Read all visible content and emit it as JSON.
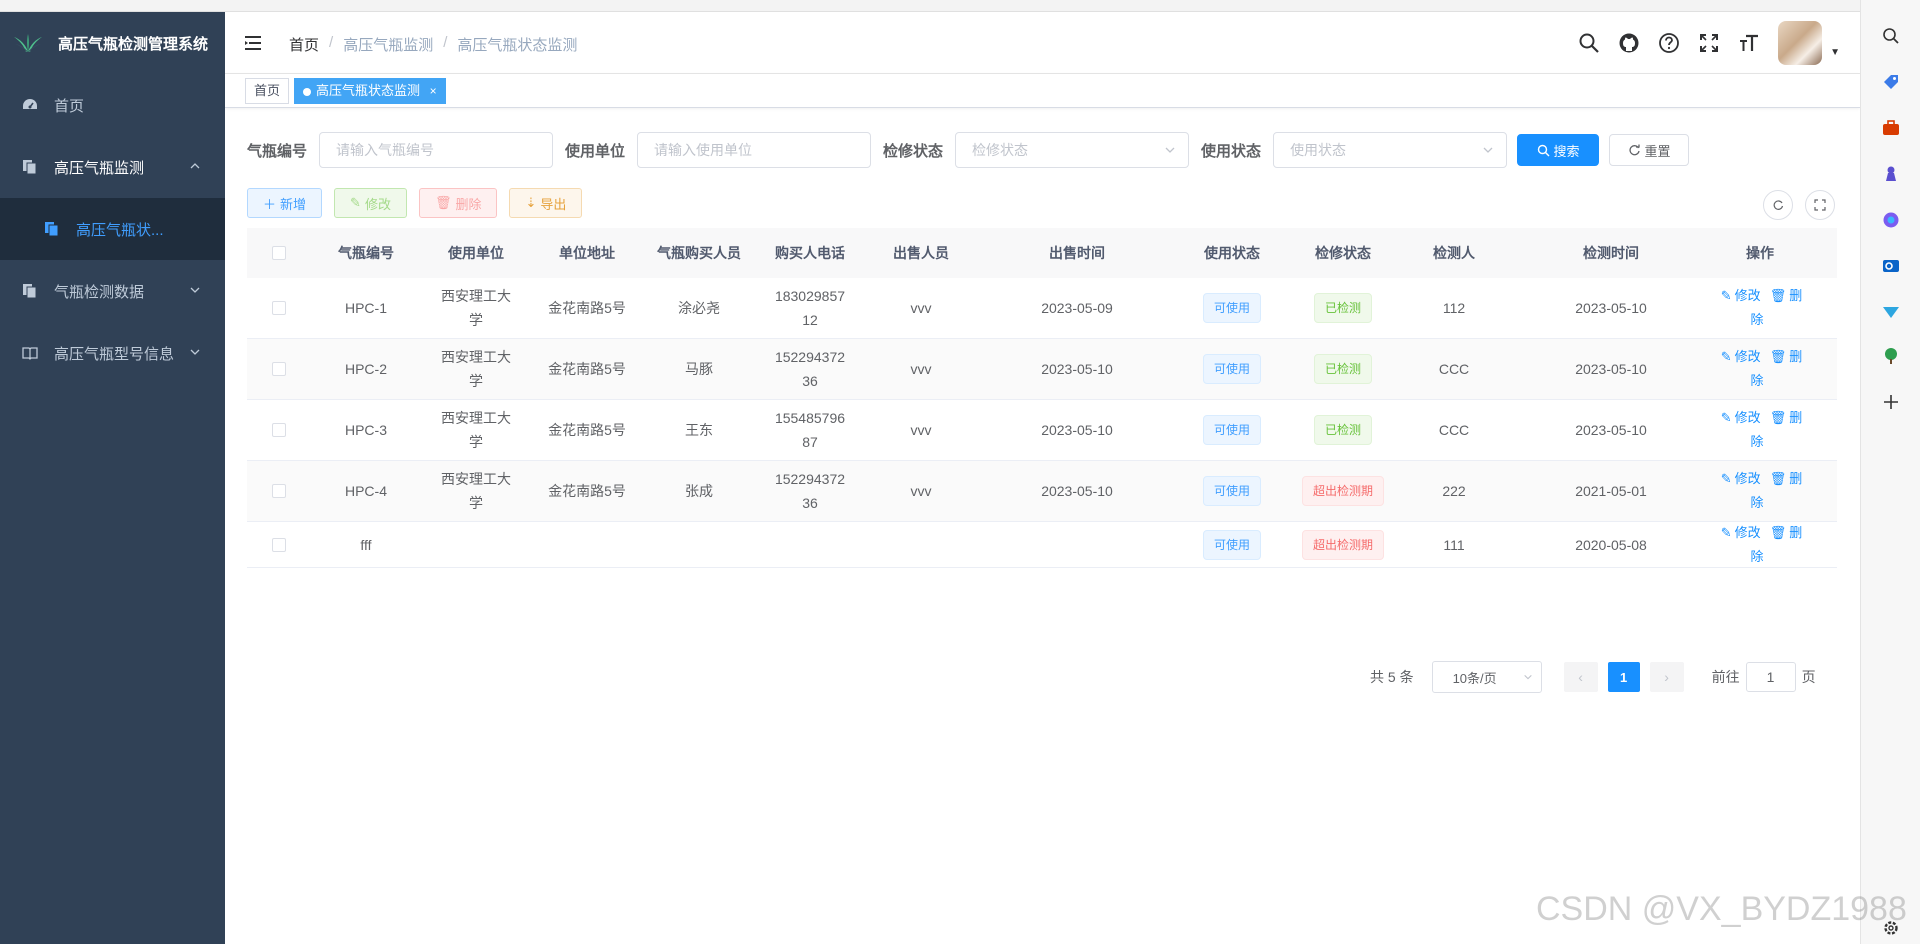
{
  "app": {
    "title": "高压气瓶检测管理系统"
  },
  "sidebar": {
    "items": [
      {
        "label": "首页"
      },
      {
        "label": "高压气瓶监测"
      },
      {
        "label": "气瓶检测数据"
      },
      {
        "label": "高压气瓶型号信息"
      }
    ],
    "sub_item": "高压气瓶状..."
  },
  "breadcrumb": {
    "home": "首页",
    "sep": "/",
    "level1": "高压气瓶监测",
    "level2": "高压气瓶状态监测"
  },
  "tags": {
    "home": "首页",
    "active": "高压气瓶状态监测",
    "close": "×"
  },
  "search": {
    "cylinder_no_label": "气瓶编号",
    "cylinder_no_placeholder": "请输入气瓶编号",
    "unit_label": "使用单位",
    "unit_placeholder": "请输入使用单位",
    "inspection_label": "检修状态",
    "inspection_placeholder": "检修状态",
    "usage_label": "使用状态",
    "usage_placeholder": "使用状态",
    "search_btn": "搜索",
    "reset_btn": "重置"
  },
  "toolbar": {
    "add": "新增",
    "edit": "修改",
    "delete": "删除",
    "export": "导出"
  },
  "table": {
    "headers": [
      "气瓶编号",
      "使用单位",
      "单位地址",
      "气瓶购买人员",
      "购买人电话",
      "出售人员",
      "出售时间",
      "使用状态",
      "检修状态",
      "检测人",
      "检测时间",
      "操作"
    ],
    "rows": [
      {
        "no": "HPC-1",
        "unit": "西安理工大学",
        "addr": "金花南路5号",
        "buyer": "涂必尧",
        "phone": "18302985712",
        "seller": "vvv",
        "sale_time": "2023-05-09",
        "usage": "可使用",
        "insp": "已检测",
        "insp_color": "green",
        "inspector": "112",
        "insp_time": "2023-05-10"
      },
      {
        "no": "HPC-2",
        "unit": "西安理工大学",
        "addr": "金花南路5号",
        "buyer": "马豚",
        "phone": "15229437236",
        "seller": "vvv",
        "sale_time": "2023-05-10",
        "usage": "可使用",
        "insp": "已检测",
        "insp_color": "green",
        "inspector": "CCC",
        "insp_time": "2023-05-10"
      },
      {
        "no": "HPC-3",
        "unit": "西安理工大学",
        "addr": "金花南路5号",
        "buyer": "王东",
        "phone": "15548579687",
        "seller": "vvv",
        "sale_time": "2023-05-10",
        "usage": "可使用",
        "insp": "已检测",
        "insp_color": "green",
        "inspector": "CCC",
        "insp_time": "2023-05-10"
      },
      {
        "no": "HPC-4",
        "unit": "西安理工大学",
        "addr": "金花南路5号",
        "buyer": "张成",
        "phone": "15229437236",
        "seller": "vvv",
        "sale_time": "2023-05-10",
        "usage": "可使用",
        "insp": "超出检测期",
        "insp_color": "red",
        "inspector": "222",
        "insp_time": "2021-05-01"
      },
      {
        "no": "fff",
        "unit": "",
        "addr": "",
        "buyer": "",
        "phone": "",
        "seller": "",
        "sale_time": "",
        "usage": "可使用",
        "insp": "超出检测期",
        "insp_color": "red",
        "inspector": "111",
        "insp_time": "2020-05-08"
      }
    ],
    "op_edit": "修改",
    "op_delete": "删除"
  },
  "pagination": {
    "total": "共 5 条",
    "page_size": "10条/页",
    "current": "1",
    "goto_prefix": "前往",
    "goto_value": "1",
    "goto_suffix": "页"
  },
  "watermark": "CSDN @VX_BYDZ1988",
  "colors": {
    "sidebar_bg": "#304156",
    "submenu_bg": "#1f2d3d",
    "primary": "#1890ff",
    "active_tag": "#42a5f5"
  }
}
